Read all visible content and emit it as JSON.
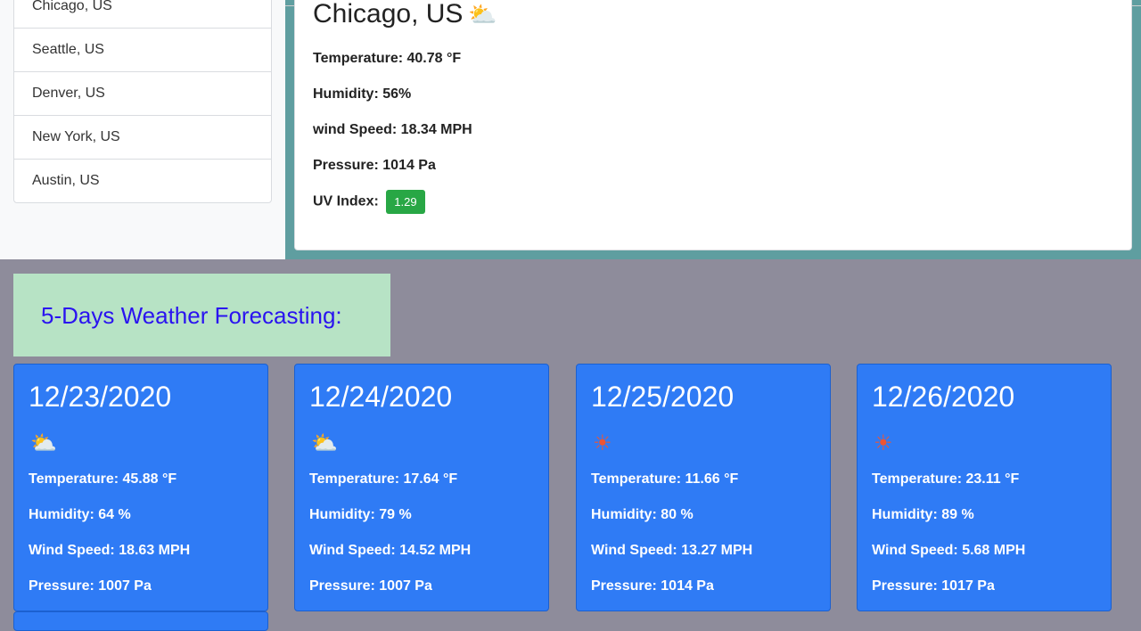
{
  "cities": [
    "Chicago, US",
    "Seattle, US",
    "Denver, US",
    "New York, US",
    "Austin, US"
  ],
  "current": {
    "city": "Chicago, US",
    "icon": "cloud-sun-icon",
    "icon_glyph": "⛅",
    "temperature": "Temperature: 40.78 °F",
    "humidity": "Humidity: 56%",
    "wind": "wind Speed: 18.34 MPH",
    "pressure": "Pressure: 1014 Pa",
    "uv_label": "UV Index:",
    "uv_value": "1.29",
    "uv_color": "#28a745"
  },
  "forecast": {
    "heading": "5-Days Weather Forecasting:",
    "days": [
      {
        "date": "12/23/2020",
        "icon": "cloud-icon",
        "icon_glyph": "⛅",
        "temperature": "Temperature: 45.88 °F",
        "humidity": "Humidity: 64 %",
        "wind": "Wind Speed: 18.63 MPH",
        "pressure": "Pressure: 1007 Pa"
      },
      {
        "date": "12/24/2020",
        "icon": "cloud-icon",
        "icon_glyph": "⛅",
        "temperature": "Temperature: 17.64 °F",
        "humidity": "Humidity: 79 %",
        "wind": "Wind Speed: 14.52 MPH",
        "pressure": "Pressure: 1007 Pa"
      },
      {
        "date": "12/25/2020",
        "icon": "sun-icon",
        "icon_glyph": "☀",
        "temperature": "Temperature: 11.66 °F",
        "humidity": "Humidity: 80 %",
        "wind": "Wind Speed: 13.27 MPH",
        "pressure": "Pressure: 1014 Pa"
      },
      {
        "date": "12/26/2020",
        "icon": "sun-icon",
        "icon_glyph": "☀",
        "temperature": "Temperature: 23.11 °F",
        "humidity": "Humidity: 89 %",
        "wind": "Wind Speed: 5.68 MPH",
        "pressure": "Pressure: 1017 Pa"
      }
    ]
  },
  "colors": {
    "forecast_card": "#2f7bf5",
    "heading_text": "#2a13f0",
    "heading_bg": "#b7e3c5",
    "page_bg": "#8e8c9b",
    "current_band": "#5f9ea0"
  }
}
